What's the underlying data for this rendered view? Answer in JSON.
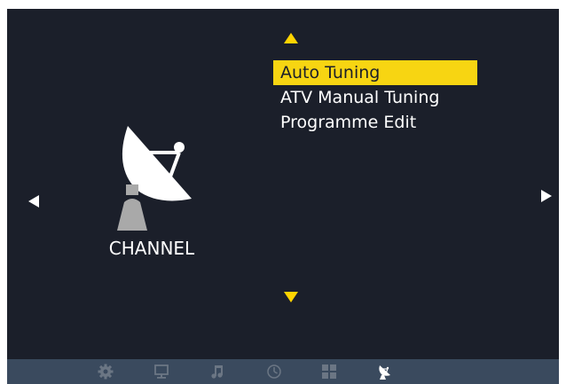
{
  "category": {
    "label": "CHANNEL",
    "icon": "satellite-dish-icon"
  },
  "menu": {
    "items": [
      {
        "label": "Auto Tuning",
        "selected": true
      },
      {
        "label": "ATV Manual Tuning",
        "selected": false
      },
      {
        "label": "Programme Edit",
        "selected": false
      }
    ]
  },
  "navigation": {
    "up": "triangle-up-icon",
    "down": "triangle-down-icon",
    "left": "triangle-left-icon",
    "right": "triangle-right-icon"
  },
  "bottom_bar": {
    "icons": [
      "gear-icon",
      "monitor-icon",
      "music-note-icon",
      "clock-icon",
      "grid-icon",
      "satellite-dish-icon"
    ],
    "active": "satellite-dish-icon"
  },
  "colors": {
    "background": "#1b1f2a",
    "highlight": "#f7d512",
    "bottom_bar": "#3a4a5e",
    "arrow_vertical": "#ffd400"
  }
}
